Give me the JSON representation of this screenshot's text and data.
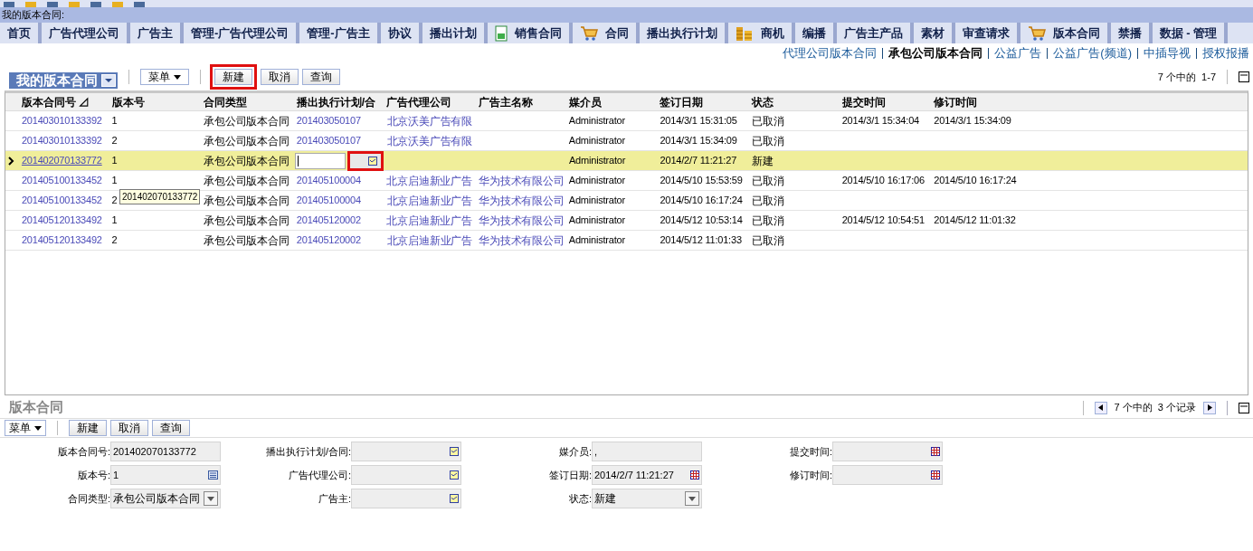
{
  "page_title": "我的版本合同:",
  "tabs": [
    {
      "label": "首页",
      "kind": "plain"
    },
    {
      "label": "广告代理公司",
      "kind": "plain"
    },
    {
      "label": "广告主",
      "kind": "plain"
    },
    {
      "label": "管理-广告代理公司",
      "kind": "plain"
    },
    {
      "label": "管理-广告主",
      "kind": "plain"
    },
    {
      "label": "协议",
      "kind": "plain"
    },
    {
      "label": "播出计划",
      "kind": "plain"
    },
    {
      "label": "销售合同",
      "kind": "document"
    },
    {
      "label": "合同",
      "kind": "cart"
    },
    {
      "label": "播出执行计划",
      "kind": "plain"
    },
    {
      "label": "商机",
      "kind": "coins"
    },
    {
      "label": "编播",
      "kind": "plain"
    },
    {
      "label": "广告主产品",
      "kind": "plain"
    },
    {
      "label": "素材",
      "kind": "plain"
    },
    {
      "label": "审查请求",
      "kind": "plain"
    },
    {
      "label": "版本合同",
      "kind": "cart"
    },
    {
      "label": "禁播",
      "kind": "plain"
    },
    {
      "label": "数据 - 管理",
      "kind": "plain"
    }
  ],
  "sub_links": [
    {
      "label": "代理公司版本合同",
      "selected": false
    },
    {
      "label": "承包公司版本合同",
      "selected": true
    },
    {
      "label": "公益广告",
      "selected": false
    },
    {
      "label": "公益广告(频道)",
      "selected": false
    },
    {
      "label": "中插导视",
      "selected": false
    },
    {
      "label": "授权报播",
      "selected": false
    }
  ],
  "list_view": {
    "title": "我的版本合同",
    "menu": "菜单",
    "buttons": [
      {
        "label": "新建",
        "highlighted": true
      },
      {
        "label": "取消",
        "highlighted": false
      },
      {
        "label": "查询",
        "highlighted": false
      }
    ],
    "pager": "7 个中的  1-7"
  },
  "table": {
    "columns": [
      "版本合同号 ⊿",
      "版本号",
      "合同类型",
      "播出执行计划/合",
      "广告代理公司",
      "广告主名称",
      "媒介员",
      "签订日期",
      "状态",
      "提交时间",
      "修订时间"
    ],
    "rows": [
      {
        "selected": false,
        "cells": [
          "201403010133392",
          "1",
          "承包公司版本合同",
          "201403050107",
          "北京沃美广告有限",
          "",
          "Administrator",
          "2014/3/1 15:31:05",
          "已取消",
          "2014/3/1 15:34:04",
          "2014/3/1 15:34:09"
        ]
      },
      {
        "selected": false,
        "cells": [
          "201403010133392",
          "2",
          "承包公司版本合同",
          "201403050107",
          "北京沃美广告有限",
          "",
          "Administrator",
          "2014/3/1 15:34:09",
          "已取消",
          "",
          ""
        ]
      },
      {
        "selected": true,
        "cells": [
          "201402070133772",
          "1",
          "承包公司版本合同",
          "",
          "",
          "",
          "Administrator",
          "2014/2/7 11:21:27",
          "新建",
          "",
          ""
        ]
      },
      {
        "selected": false,
        "cells": [
          "201405100133452",
          "1",
          "承包公司版本合同",
          "201405100004",
          "北京启迪新业广告",
          "华为技术有限公司",
          "Administrator",
          "2014/5/10 15:53:59",
          "已取消",
          "2014/5/10 16:17:06",
          "2014/5/10 16:17:24"
        ]
      },
      {
        "selected": false,
        "cells": [
          "201405100133452",
          "2",
          "承包公司版本合同",
          "201405100004",
          "北京启迪新业广告",
          "华为技术有限公司",
          "Administrator",
          "2014/5/10 16:17:24",
          "已取消",
          "",
          ""
        ]
      },
      {
        "selected": false,
        "cells": [
          "201405120133492",
          "1",
          "承包公司版本合同",
          "201405120002",
          "北京启迪新业广告",
          "华为技术有限公司",
          "Administrator",
          "2014/5/12 10:53:14",
          "已取消",
          "2014/5/12 10:54:51",
          "2014/5/12 11:01:32"
        ]
      },
      {
        "selected": false,
        "cells": [
          "201405120133492",
          "2",
          "承包公司版本合同",
          "201405120002",
          "北京启迪新业广告",
          "华为技术有限公司",
          "Administrator",
          "2014/5/12 11:01:33",
          "已取消",
          "",
          ""
        ]
      }
    ],
    "tooltip": "201402070133772"
  },
  "detail": {
    "title": "版本合同",
    "pager": "7 个中的  3 个记录",
    "menu": "菜单",
    "buttons": [
      "新建",
      "取消",
      "查询"
    ],
    "columns": [
      [
        {
          "label": "版本合同号:",
          "value": "201402070133772",
          "kind": "text"
        },
        {
          "label": "版本号:",
          "value": "1",
          "kind": "calc"
        },
        {
          "label": "合同类型:",
          "value": "承包公司版本合同",
          "kind": "select"
        }
      ],
      [
        {
          "label": "播出执行计划/合同:",
          "kind": "picker"
        },
        {
          "label": "广告代理公司:",
          "kind": "picker"
        },
        {
          "label": "广告主:",
          "kind": "picker"
        }
      ],
      [
        {
          "label": "媒介员:",
          "value": ",",
          "kind": "text"
        },
        {
          "label": "签订日期:",
          "value": "2014/2/7 11:21:27",
          "kind": "date"
        },
        {
          "label": "状态:",
          "value": "新建",
          "kind": "select"
        }
      ],
      [
        {
          "label": "提交时间:",
          "kind": "date"
        },
        {
          "label": "修订时间:",
          "kind": "date"
        }
      ]
    ]
  }
}
